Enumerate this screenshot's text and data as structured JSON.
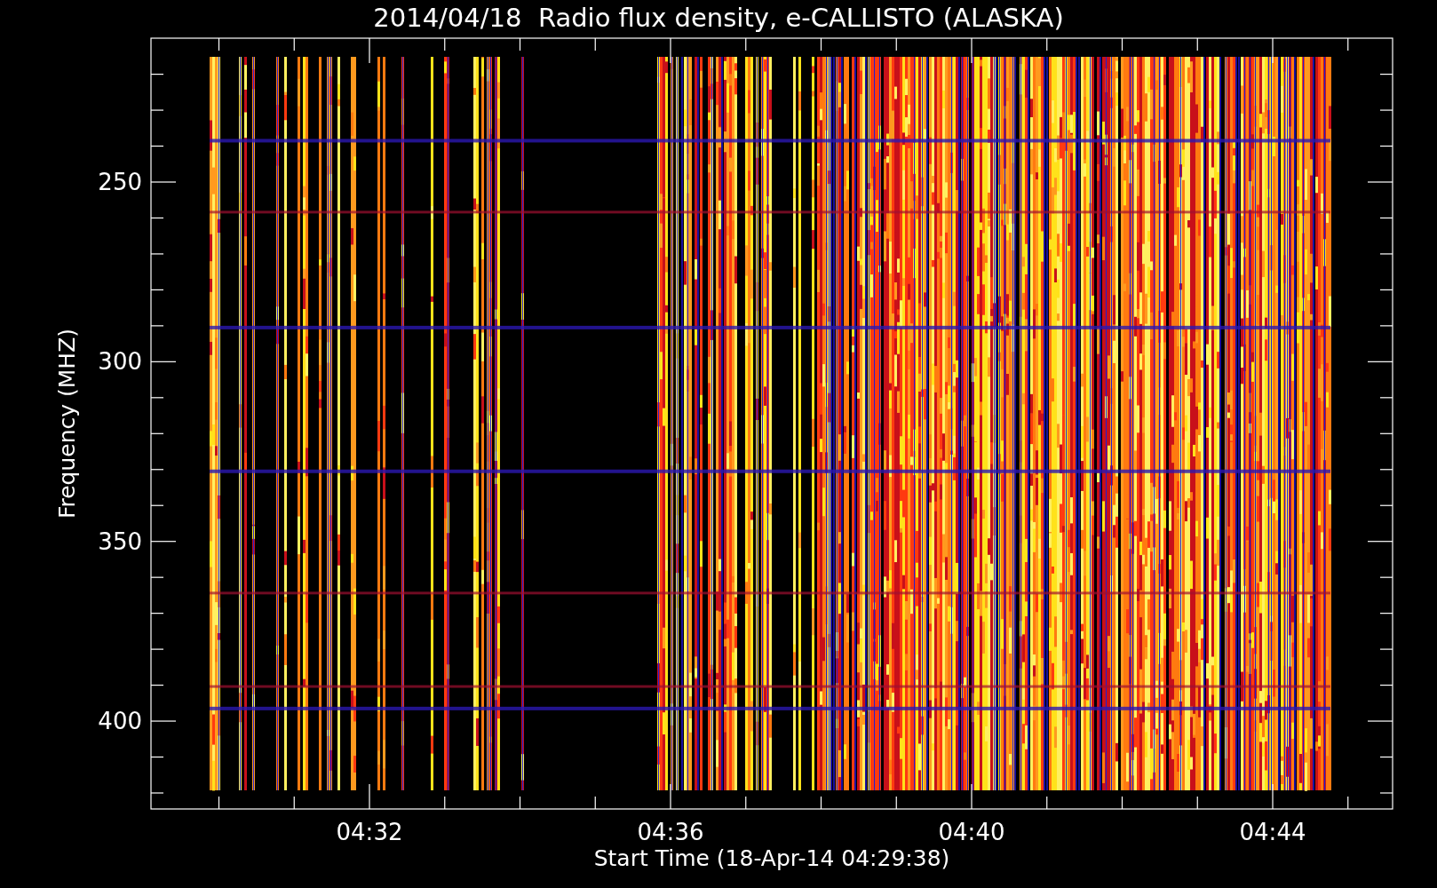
{
  "title": "2014/04/18  Radio flux density, e-CALLISTO (ALASKA)",
  "plot": {
    "ylabel": "Frequency (MHZ)",
    "xlabel": "Start Time (18-Apr-14 04:29:38)",
    "yticks": [
      "250",
      "300",
      "350",
      "400"
    ],
    "xticks": [
      "04:32",
      "04:36",
      "04:40",
      "04:44"
    ]
  }
}
